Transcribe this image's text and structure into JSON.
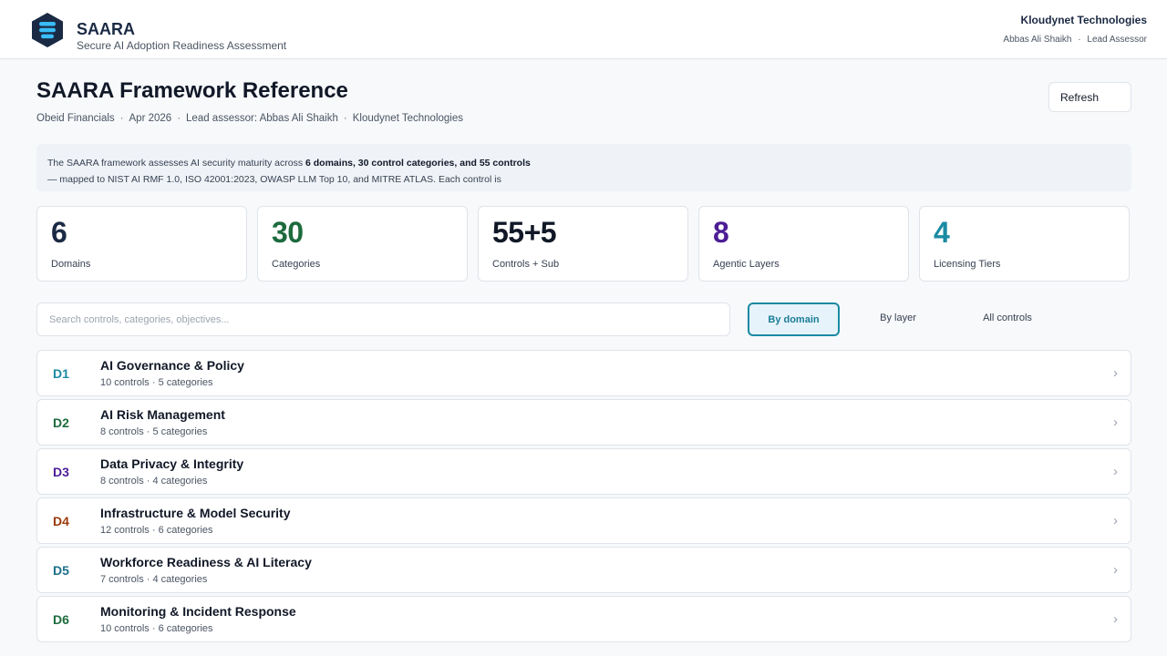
{
  "header": {
    "brand_title": "SAARA",
    "brand_subtitle": "Secure AI Adoption Readiness Assessment",
    "org_name": "Kloudynet Technologies",
    "user_name": "Abbas Ali Shaikh",
    "user_separator": "·",
    "user_role": "Lead Assessor",
    "logo_icon": "stacked-layers-hexagon-icon"
  },
  "page": {
    "title": "SAARA Framework Reference",
    "meta": [
      "Obeid Financials",
      "Apr 2026",
      "Lead assessor: Abbas Ali Shaikh",
      "Kloudynet Technologies"
    ],
    "meta_separator": "·",
    "refresh_label": "Refresh"
  },
  "intro": {
    "text_before": "The SAARA framework assesses AI security maturity across ",
    "text_bold": "6 domains, 30 control categories, and 55 controls",
    "text_after": "— mapped to NIST AI RMF 1.0, ISO 42001:2023, OWASP LLM Top 10, and MITRE ATLAS. Each control is"
  },
  "stats": [
    {
      "value": "6",
      "label": "Domains",
      "color": "#1b2a44"
    },
    {
      "value": "30",
      "label": "Categories",
      "color": "#1d6b3c"
    },
    {
      "value": "55+5",
      "label": "Controls + Sub",
      "color": "#111827"
    },
    {
      "value": "8",
      "label": "Agentic Layers",
      "color": "#4c1d95"
    },
    {
      "value": "4",
      "label": "Licensing Tiers",
      "color": "#1b8aa3"
    }
  ],
  "search": {
    "placeholder": "Search controls, categories, objectives..."
  },
  "view_tabs": [
    {
      "label": "By domain",
      "active": true
    },
    {
      "label": "By layer",
      "active": false
    },
    {
      "label": "All controls",
      "active": false
    }
  ],
  "domains": [
    {
      "code": "D1",
      "name": "AI Governance & Policy",
      "meta": "10 controls · 5 categories",
      "color": "#1b8aa3"
    },
    {
      "code": "D2",
      "name": "AI Risk Management",
      "meta": "8 controls · 5 categories",
      "color": "#1d6b3c"
    },
    {
      "code": "D3",
      "name": "Data Privacy & Integrity",
      "meta": "8 controls · 4 categories",
      "color": "#4c1d95"
    },
    {
      "code": "D4",
      "name": "Infrastructure & Model Security",
      "meta": "12 controls · 6 categories",
      "color": "#9a3b0c"
    },
    {
      "code": "D5",
      "name": "Workforce Readiness & AI Literacy",
      "meta": "7 controls · 4 categories",
      "color": "#1b6f8a"
    },
    {
      "code": "D6",
      "name": "Monitoring & Incident Response",
      "meta": "10 controls · 6 categories",
      "color": "#1d6b3c"
    }
  ],
  "chevron_glyph": "›"
}
